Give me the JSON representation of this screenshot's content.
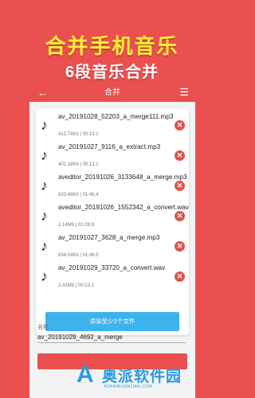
{
  "hero": {
    "title": "合并手机音乐",
    "subtitle": "6段音乐合并"
  },
  "appbar": {
    "back_icon": "←",
    "title": "合并",
    "menu_icon": "☰"
  },
  "files": [
    {
      "name": "av_20191028_52203_a_merge111.mp3",
      "meta": "412.74Kb | 00:13.1"
    },
    {
      "name": "av_20191027_9116_a_extract.mp3",
      "meta": "402.18Kb | 00:13.1"
    },
    {
      "name": "aveditor_20191026_3133648_a_merge.mp3",
      "meta": "833.48Kb | 01:46.4"
    },
    {
      "name": "aveditor_20191026_1552342_a_convert.wav",
      "meta": "2.14Mb | 01:09.9"
    },
    {
      "name": "av_20191027_3628_a_merge.mp3",
      "meta": "834.04Kb | 01:46.5"
    },
    {
      "name": "av_20191029_33720_a_convert.wav",
      "meta": "2.41Mb | 00:13.1"
    }
  ],
  "icons": {
    "note": "♪",
    "remove": "✕"
  },
  "add_button": "添加至少2个文件",
  "name_field": {
    "label": "名称",
    "value": "av_20191029_4692_a_merge"
  },
  "watermark": {
    "logo": "A",
    "text": "奥派软件园",
    "url": "AOPAIRUANJIAN.COM"
  },
  "colors": {
    "brand_red": "#e9504f",
    "title_yellow": "#ffef33",
    "button_blue": "#3db3ee"
  }
}
